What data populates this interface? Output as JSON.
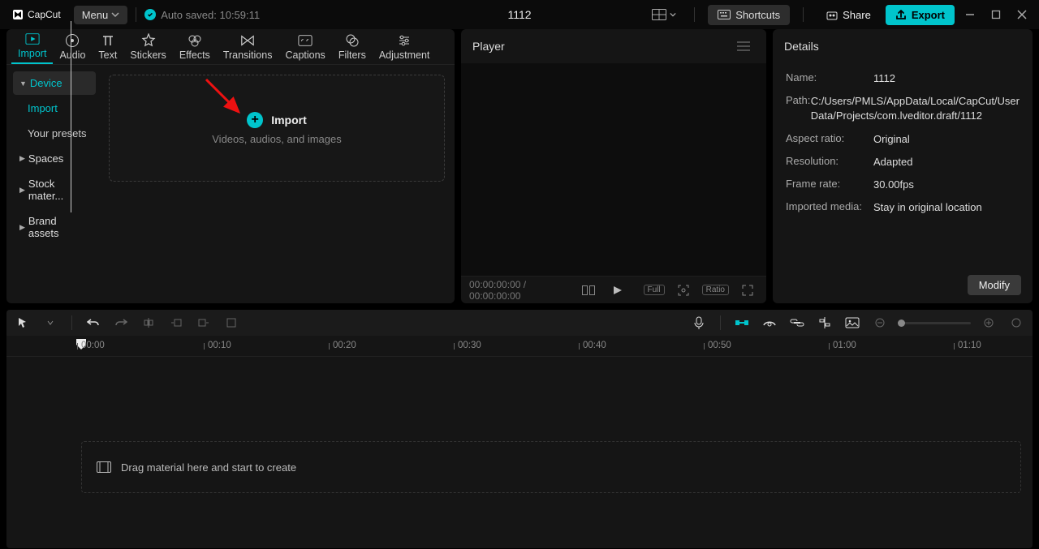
{
  "app": {
    "name": "CapCut"
  },
  "topbar": {
    "menu_label": "Menu",
    "autosave_text": "Auto saved: 10:59:11",
    "project_name": "1112",
    "shortcuts_label": "Shortcuts",
    "share_label": "Share",
    "export_label": "Export"
  },
  "tabs": {
    "import": "Import",
    "audio": "Audio",
    "text": "Text",
    "stickers": "Stickers",
    "effects": "Effects",
    "transitions": "Transitions",
    "captions": "Captions",
    "filters": "Filters",
    "adjustment": "Adjustment"
  },
  "tree": {
    "device": "Device",
    "import": "Import",
    "your_presets": "Your presets",
    "spaces": "Spaces",
    "stock": "Stock mater...",
    "brand": "Brand assets"
  },
  "import_drop": {
    "title": "Import",
    "sub": "Videos, audios, and images"
  },
  "player": {
    "title": "Player",
    "time_current": "00:00:00:00",
    "time_sep": " / ",
    "time_total": "00:00:00:00",
    "full": "Full",
    "ratio": "Ratio"
  },
  "details": {
    "title": "Details",
    "name_k": "Name:",
    "name_v": "1112",
    "path_k": "Path:",
    "path_v": "C:/Users/PMLS/AppData/Local/CapCut/User Data/Projects/com.lveditor.draft/1112",
    "aspect_k": "Aspect ratio:",
    "aspect_v": "Original",
    "res_k": "Resolution:",
    "res_v": "Adapted",
    "fps_k": "Frame rate:",
    "fps_v": "30.00fps",
    "media_k": "Imported media:",
    "media_v": "Stay in original location",
    "modify": "Modify"
  },
  "timeline": {
    "ticks": [
      "00:00",
      "00:10",
      "00:20",
      "00:30",
      "00:40",
      "00:50",
      "01:00",
      "01:10"
    ],
    "drop_hint": "Drag material here and start to create"
  }
}
